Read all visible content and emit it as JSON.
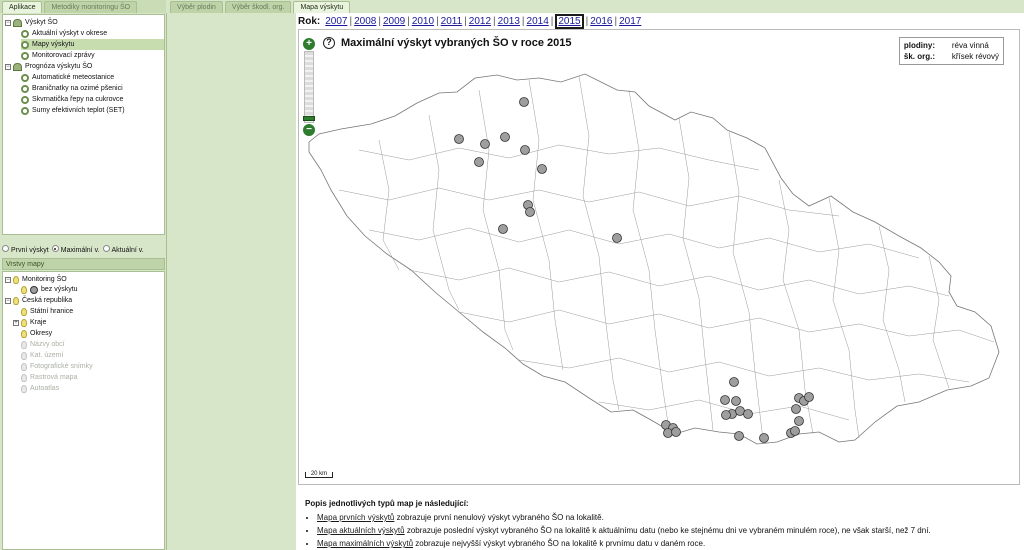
{
  "left_tabs": [
    "Aplikace",
    "Metodiky monitoringu ŠO"
  ],
  "top_tabs": [
    "Výběr plodin",
    "Výběr škodl. org.",
    "Mapa výskytu"
  ],
  "tree": {
    "items": [
      {
        "label": "Výskyt ŠO"
      },
      {
        "label": "Aktuální výskyt v okrese"
      },
      {
        "label": "Mapy výskytu"
      },
      {
        "label": "Monitorovací zprávy"
      },
      {
        "label": "Prognóza výskytu ŠO"
      },
      {
        "label": "Automatické meteostanice"
      },
      {
        "label": "Braničnatky na ozimé pšenici"
      },
      {
        "label": "Skvrnatička řepy na cukrovce"
      },
      {
        "label": "Sumy efektivních teplot (SET)"
      }
    ]
  },
  "radios": [
    "První výskyt",
    "Maximální v.",
    "Aktuální v."
  ],
  "layers": {
    "header": "Vrstvy mapy",
    "items": [
      {
        "label": "Monitoring ŠO"
      },
      {
        "label": "bez výskytu"
      },
      {
        "label": "Česká republika"
      },
      {
        "label": "Státní hranice"
      },
      {
        "label": "Kraje"
      },
      {
        "label": "Okresy"
      },
      {
        "label": "Názvy obcí"
      },
      {
        "label": "Kat. území"
      },
      {
        "label": "Fotografické snímky"
      },
      {
        "label": "Rastrová mapa"
      },
      {
        "label": "Autoatlas"
      }
    ]
  },
  "years": {
    "label": "Rok:",
    "list": [
      "2007",
      "2008",
      "2009",
      "2010",
      "2011",
      "2012",
      "2013",
      "2014",
      "2015",
      "2016",
      "2017"
    ],
    "selected": "2015"
  },
  "map": {
    "title": "Maximální výskyt vybraných ŠO v roce 2015",
    "help_symbol": "?",
    "info": {
      "plodiny_label": "plodiny:",
      "plodiny_value": "réva vinná",
      "org_label": "šk. org.:",
      "org_value": "křísek révový"
    },
    "zoom_in": "+",
    "zoom_out": "−",
    "scale": "20 km"
  },
  "description": {
    "heading": "Popis jednotlivých typů map je následující:",
    "items": [
      {
        "link": "Mapa prvních výskytů",
        "text": " zobrazuje první nenulový výskyt vybraného ŠO na lokalitě."
      },
      {
        "link": "Mapa aktuálních výskytů",
        "text": " zobrazuje poslední výskyt vybraného ŠO na lokalitě k aktuálnímu datu (nebo ke stejnému dni ve vybraném minulém roce), ne však starší, než 7 dní."
      },
      {
        "link": "Mapa maximálních výskytů",
        "text": " zobrazuje nejvyšší výskyt vybraného ŠO na lokalitě k prvnímu datu v daném roce."
      }
    ]
  },
  "colors": {
    "panel": "#d7e6c8",
    "accent": "#2e7d2e",
    "marker": "#9e9e9e"
  }
}
